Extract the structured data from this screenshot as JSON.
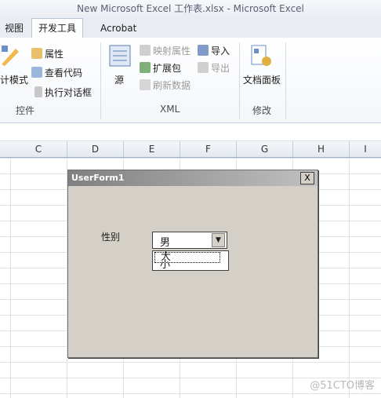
{
  "window": {
    "title": "New Microsoft Excel 工作表.xlsx - Microsoft Excel"
  },
  "tabs": [
    "视图",
    "开发工具",
    "Acrobat"
  ],
  "ribbon": {
    "controls": {
      "design_mode": "计模式",
      "properties": "属性",
      "view_code": "查看代码",
      "run_dialog": "执行对话框",
      "group": "控件"
    },
    "xml": {
      "source": "源",
      "map_properties": "映射属性",
      "expansion_packs": "扩展包",
      "refresh_data": "刷新数据",
      "import": "导入",
      "export": "导出",
      "group": "XML"
    },
    "modify": {
      "document_panel": "文档面板",
      "group": "修改"
    }
  },
  "columns": [
    "C",
    "D",
    "E",
    "F",
    "G",
    "H",
    "I"
  ],
  "userform": {
    "title": "UserForm1",
    "close": "X",
    "label": "性别",
    "combo_value": "男",
    "options": [
      "大",
      "小"
    ]
  },
  "watermark": "@51CTO博客"
}
